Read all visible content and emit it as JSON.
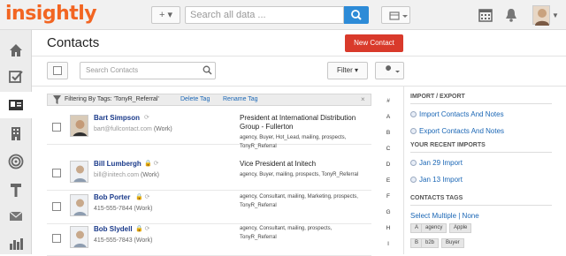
{
  "app": {
    "logo": "insightly"
  },
  "topbar": {
    "add_label": "+ ▾",
    "search_placeholder": "Search all data ...",
    "grid_label": "▦ ▾"
  },
  "sidebar": {
    "items": [
      {
        "name": "home-icon"
      },
      {
        "name": "tasks-icon"
      },
      {
        "name": "contacts-icon"
      },
      {
        "name": "organizations-icon"
      },
      {
        "name": "target-icon"
      },
      {
        "name": "projects-icon"
      },
      {
        "name": "email-icon"
      },
      {
        "name": "reports-icon"
      }
    ]
  },
  "page": {
    "title": "Contacts",
    "new_contact": "New Contact"
  },
  "toolbar": {
    "search_placeholder": "Search Contacts",
    "filter_label": "Filter ▾"
  },
  "filter_bar": {
    "text": "Filtering By Tags: 'TonyR_Referral'",
    "delete_tag": "Delete Tag",
    "rename_tag": "Rename Tag",
    "close": "×"
  },
  "contacts": [
    {
      "name": "Bart Simpson",
      "email": "bart@fullcontact.com",
      "email_type": "(Work)",
      "title": "President at International Distribution Group - Fullerton",
      "tags": "agency, Buyer, Hot_Lead, mailing, prospects, TonyR_Referral"
    },
    {
      "name": "Bill Lumbergh",
      "email": "bill@initech.com",
      "email_type": "(Work)",
      "title": "Vice President at Initech",
      "tags": "agency, Buyer, mailing, prospects, TonyR_Referral"
    },
    {
      "name": "Bob Porter",
      "email": "415-555-7844",
      "email_type": "(Work)",
      "title": "",
      "tags": "agency, Consultant, mailing, Marketing, prospects, TonyR_Referral"
    },
    {
      "name": "Bob Slydell",
      "email": "415-555-7843",
      "email_type": "(Work)",
      "title": "",
      "tags": "agency, Consultant, mailing, prospects, TonyR_Referral"
    }
  ],
  "alphabet": [
    "#",
    "A",
    "B",
    "C",
    "D",
    "E",
    "F",
    "G",
    "H",
    "I"
  ],
  "right_panel": {
    "import_export_title": "IMPORT / EXPORT",
    "import_link": "Import Contacts And Notes",
    "export_link": "Export Contacts And Notes",
    "recent_imports_title": "YOUR RECENT IMPORTS",
    "recent_1": "Jan 29 Import",
    "recent_2": "Jan 13 Import",
    "tags_title": "CONTACTS TAGS",
    "select_multiple": "Select Multiple | None",
    "tags": [
      "A",
      "agency",
      "Apple",
      "B",
      "b2b",
      "Buyer"
    ]
  }
}
